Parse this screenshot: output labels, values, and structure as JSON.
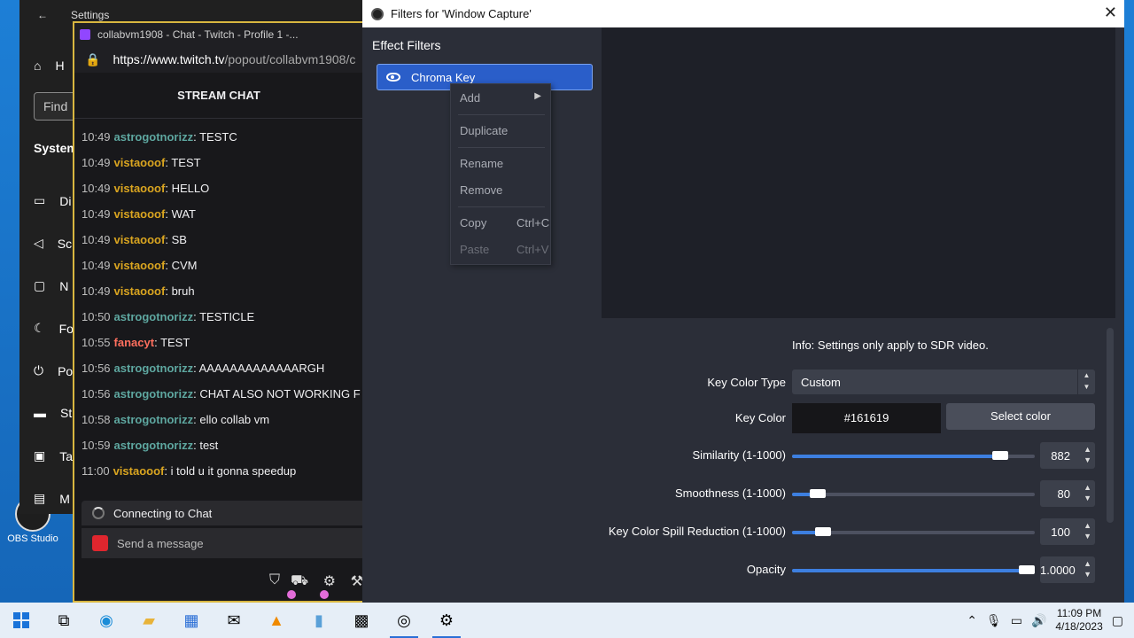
{
  "settings": {
    "title": "Settings",
    "nav_home": "H",
    "find": "Find",
    "system": "System",
    "items": [
      "Di",
      "Sc",
      "N",
      "Fo",
      "Po",
      "St",
      "Ta",
      "M"
    ]
  },
  "desktop": {
    "obs_icon_label": "OBS Studio"
  },
  "chat": {
    "window_title": "collabvm1908 - Chat - Twitch - Profile 1 -...",
    "url_host": "https://www.twitch.tv",
    "url_path": "/popout/collabvm1908/c",
    "header": "STREAM CHAT",
    "messages": [
      {
        "time": "10:49",
        "user": "astrogotnorizz",
        "color": "#5ea7a0",
        "text": ": TESTC"
      },
      {
        "time": "10:49",
        "user": "vistaooof",
        "color": "#daa520",
        "text": ": TEST"
      },
      {
        "time": "10:49",
        "user": "vistaooof",
        "color": "#daa520",
        "text": ": HELLO"
      },
      {
        "time": "10:49",
        "user": "vistaooof",
        "color": "#daa520",
        "text": ": WAT"
      },
      {
        "time": "10:49",
        "user": "vistaooof",
        "color": "#daa520",
        "text": ": SB"
      },
      {
        "time": "10:49",
        "user": "vistaooof",
        "color": "#daa520",
        "text": ": CVM"
      },
      {
        "time": "10:49",
        "user": "vistaooof",
        "color": "#daa520",
        "text": ": bruh"
      },
      {
        "time": "10:50",
        "user": "astrogotnorizz",
        "color": "#5ea7a0",
        "text": ": TESTICLE"
      },
      {
        "time": "10:55",
        "user": "fanacyt",
        "color": "#ff6f5e",
        "text": ": TEST"
      },
      {
        "time": "10:56",
        "user": "astrogotnorizz",
        "color": "#5ea7a0",
        "text": ": AAAAAAAAAAAAARGH"
      },
      {
        "time": "10:56",
        "user": "astrogotnorizz",
        "color": "#5ea7a0",
        "text": ": CHAT ALSO NOT WORKING F"
      },
      {
        "time": "10:58",
        "user": "astrogotnorizz",
        "color": "#5ea7a0",
        "text": ": ello collab vm"
      },
      {
        "time": "10:59",
        "user": "astrogotnorizz",
        "color": "#5ea7a0",
        "text": ": test"
      },
      {
        "time": "11:00",
        "user": "vistaooof",
        "color": "#daa520",
        "text": ": i told u it gonna speedup"
      }
    ],
    "status": "Connecting to Chat",
    "input_placeholder": "Send a message"
  },
  "obs": {
    "title": "Filters for 'Window Capture'",
    "close": "✕",
    "effect_filters": "Effect Filters",
    "filter_name": "Chroma Key",
    "info": "Info: Settings only apply to SDR video.",
    "key_color_type_label": "Key Color Type",
    "key_color_type_value": "Custom",
    "key_color_label": "Key Color",
    "key_color_value": "#161619",
    "select_color": "Select color",
    "similarity_label": "Similarity (1-1000)",
    "similarity_value": "882",
    "similarity_fraction": 0.882,
    "smoothness_label": "Smoothness (1-1000)",
    "smoothness_value": "80",
    "smoothness_fraction": 0.08,
    "spill_label": "Key Color Spill Reduction (1-1000)",
    "spill_value": "100",
    "spill_fraction": 0.1,
    "opacity_label": "Opacity",
    "opacity_value": "1.0000",
    "opacity_fraction": 1.0
  },
  "menu": {
    "add": "Add",
    "duplicate": "Duplicate",
    "rename": "Rename",
    "remove": "Remove",
    "copy": "Copy",
    "copy_shortcut": "Ctrl+C",
    "paste": "Paste",
    "paste_shortcut": "Ctrl+V"
  },
  "taskbar": {
    "time": "11:09 PM",
    "date": "4/18/2023"
  }
}
